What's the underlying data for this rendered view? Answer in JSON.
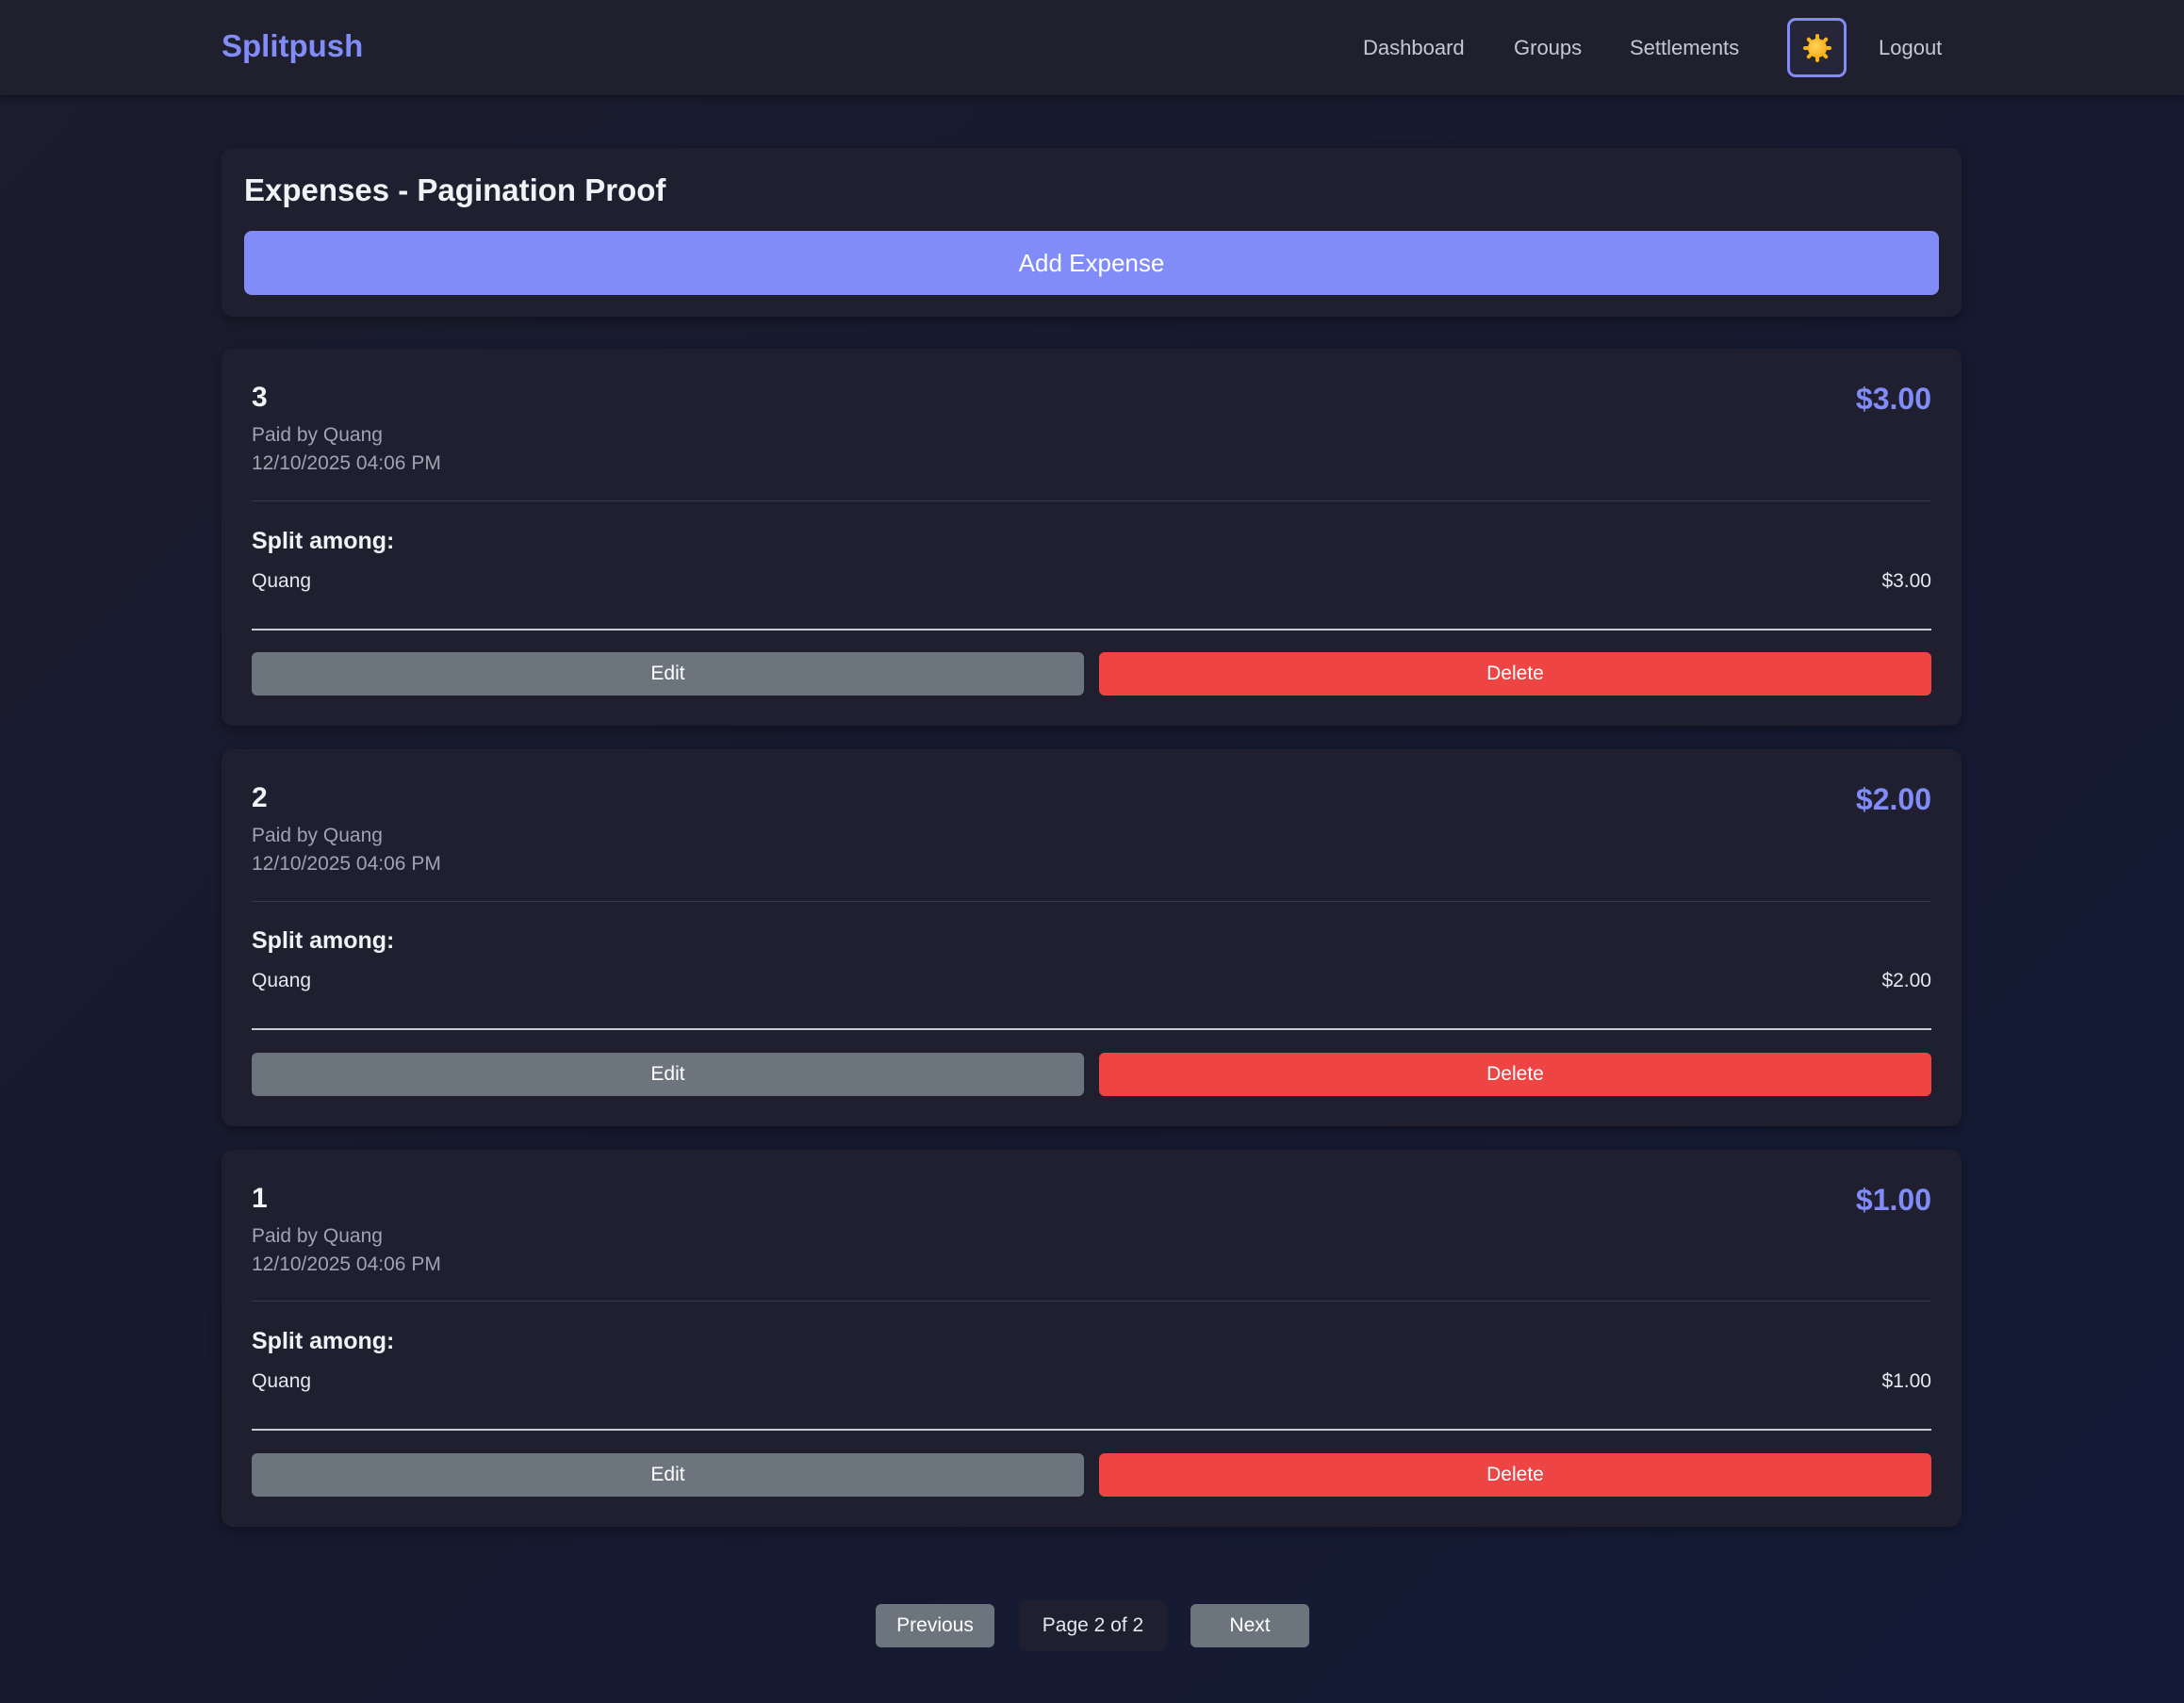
{
  "header": {
    "brand": "Splitpush",
    "nav": [
      "Dashboard",
      "Groups",
      "Settlements"
    ],
    "theme_icon": "sun-icon",
    "logout": "Logout"
  },
  "page": {
    "title": "Expenses - Pagination Proof",
    "add_label": "Add Expense"
  },
  "expenses": [
    {
      "title": "3",
      "amount": "$3.00",
      "paid_by": "Paid by Quang",
      "date": "12/10/2025 04:06 PM",
      "split_heading": "Split among:",
      "splits": [
        {
          "name": "Quang",
          "amount": "$3.00"
        }
      ],
      "edit_label": "Edit",
      "delete_label": "Delete"
    },
    {
      "title": "2",
      "amount": "$2.00",
      "paid_by": "Paid by Quang",
      "date": "12/10/2025 04:06 PM",
      "split_heading": "Split among:",
      "splits": [
        {
          "name": "Quang",
          "amount": "$2.00"
        }
      ],
      "edit_label": "Edit",
      "delete_label": "Delete"
    },
    {
      "title": "1",
      "amount": "$1.00",
      "paid_by": "Paid by Quang",
      "date": "12/10/2025 04:06 PM",
      "split_heading": "Split among:",
      "splits": [
        {
          "name": "Quang",
          "amount": "$1.00"
        }
      ],
      "edit_label": "Edit",
      "delete_label": "Delete"
    }
  ],
  "pagination": {
    "previous": "Previous",
    "info": "Page 2 of 2",
    "next": "Next"
  },
  "colors": {
    "accent": "#818cf8",
    "danger": "#ef4444",
    "secondary": "#6c757d"
  }
}
